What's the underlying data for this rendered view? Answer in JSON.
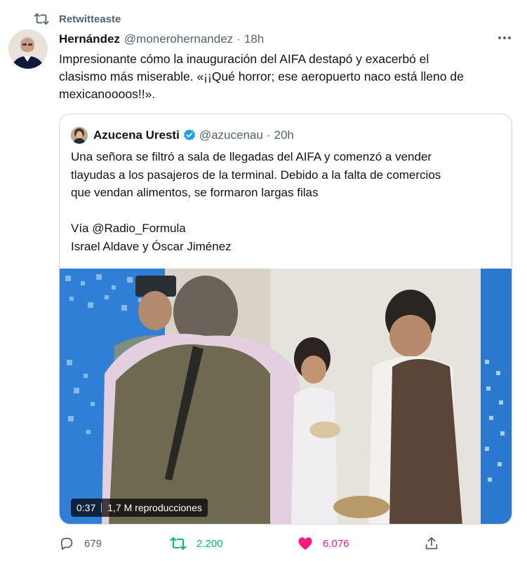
{
  "retweet": {
    "label": "Retwitteaste",
    "icon": "retweet-icon"
  },
  "tweet": {
    "author_name": "Hernández",
    "handle": "@monerohernandez",
    "separator": "·",
    "time": "18h",
    "text_lines": [
      "Impresionante cómo la inauguración del AIFA destapó y exacerbó el",
      "clasismo más miserable. «¡¡Qué horror; ese aeropuerto naco está lleno de",
      "mexicanoooos!!»."
    ],
    "more_icon": "more-horizontal-icon"
  },
  "quote": {
    "author_name": "Azucena Uresti",
    "verified_icon": "verified-badge-icon",
    "handle": "@azucenau",
    "separator": "·",
    "time": "20h",
    "text_lines": [
      "Una señora se filtró a sala de llegadas del AIFA y comenzó a vender",
      "tlayudas a los pasajeros de la terminal. Debido a la falta de comercios",
      "que vendan alimentos, se formaron largas filas",
      "",
      "Vía @Radio_Formula",
      "Israel Aldave y Óscar Jiménez"
    ],
    "video": {
      "duration": "0:37",
      "views": "1,7 M reproducciones"
    }
  },
  "actions": {
    "reply": {
      "icon": "reply-icon",
      "count": "679"
    },
    "retweet": {
      "icon": "retweet-icon",
      "count": "2.200",
      "color": "#00ba7c"
    },
    "like": {
      "icon": "heart-filled-icon",
      "count": "6.076",
      "color": "#f91880"
    },
    "share": {
      "icon": "share-icon"
    }
  },
  "colors": {
    "secondary_text": "#536471",
    "border": "#cfd9de",
    "verified": "#1d9bf0"
  }
}
